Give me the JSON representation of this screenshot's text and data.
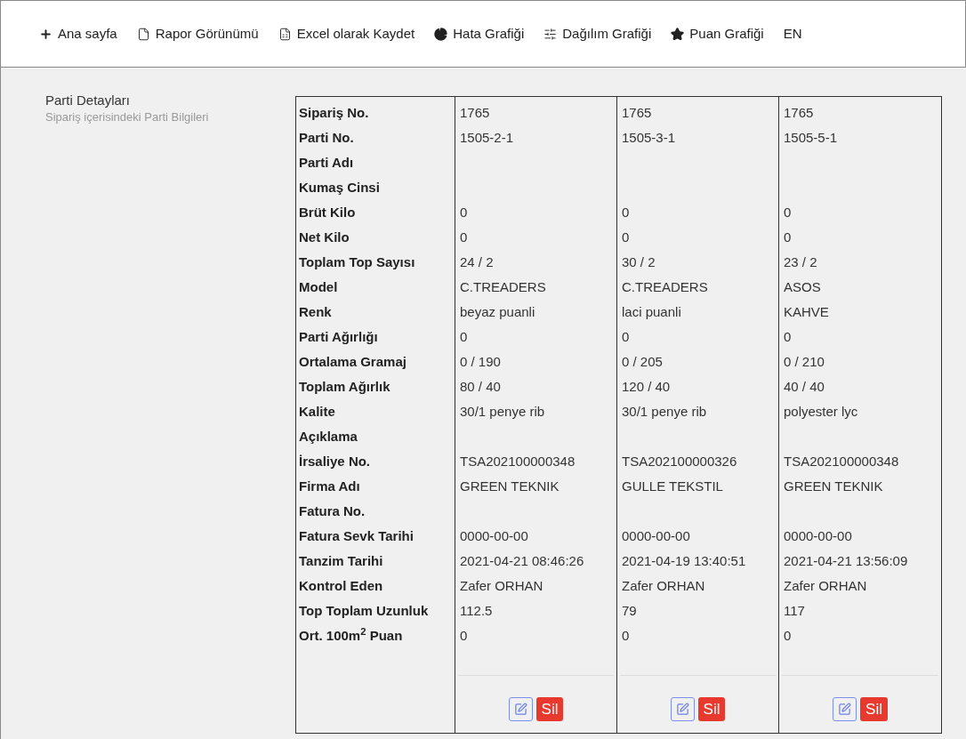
{
  "nav": [
    {
      "kind": "plus",
      "label": "Ana sayfa"
    },
    {
      "kind": "file",
      "label": "Rapor Görünümü"
    },
    {
      "kind": "excel",
      "label": "Excel olarak Kaydet"
    },
    {
      "kind": "pie",
      "label": "Hata Grafiği"
    },
    {
      "kind": "sliders",
      "label": "Dağılım Grafiği"
    },
    {
      "kind": "star",
      "label": "Puan Grafiği"
    },
    {
      "kind": "text",
      "label": "EN"
    }
  ],
  "section": {
    "title": "Parti Detayları",
    "subtitle": "Sipariş içerisindeki Parti Bilgileri"
  },
  "table": {
    "rows": [
      {
        "label": "Sipariş No.",
        "values": [
          "1765",
          "1765",
          "1765"
        ]
      },
      {
        "label": "Parti No.",
        "values": [
          "1505-2-1",
          "1505-3-1",
          "1505-5-1"
        ]
      },
      {
        "label": "Parti Adı"
      },
      {
        "label": "Kumaş Cinsi"
      },
      {
        "label": "Brüt Kilo",
        "values": [
          "0",
          "0",
          "0"
        ]
      },
      {
        "label": "Net Kilo",
        "values": [
          "0",
          "0",
          "0"
        ]
      },
      {
        "label": "Toplam Top Sayısı",
        "values": [
          "24 / 2",
          "30 / 2",
          "23 / 2"
        ]
      },
      {
        "label": "Model",
        "values": [
          "C.TREADERS",
          "C.TREADERS",
          "ASOS"
        ]
      },
      {
        "label": "Renk",
        "values": [
          "beyaz puanli",
          "laci puanli",
          "KAHVE"
        ]
      },
      {
        "label": "Parti Ağırlığı",
        "values": [
          "0",
          "0",
          "0"
        ]
      },
      {
        "label": "Ortalama Gramaj",
        "values": [
          "0 / 190",
          "0 / 205",
          "0 / 210"
        ]
      },
      {
        "label": "Toplam Ağırlık",
        "values": [
          "80 / 40",
          "120 / 40",
          "40 / 40"
        ]
      },
      {
        "label": "Kalite",
        "values": [
          "30/1 penye rib",
          "30/1 penye rib",
          "polyester lyc"
        ]
      },
      {
        "label": "Açıklama"
      },
      {
        "label": "İrsaliye No.",
        "values": [
          "TSA202100000348",
          "TSA202100000326",
          "TSA202100000348"
        ]
      },
      {
        "label": "Firma Adı",
        "values": [
          "GREEN TEKNIK",
          "GULLE TEKSTIL",
          "GREEN TEKNIK"
        ]
      },
      {
        "label": "Fatura No."
      },
      {
        "label": "Fatura Sevk Tarihi",
        "values": [
          "0000-00-00",
          "0000-00-00",
          "0000-00-00"
        ]
      },
      {
        "label": "Tanzim Tarihi",
        "values": [
          "2021-04-21 08:46:26",
          "2021-04-19 13:40:51",
          "2021-04-21 13:56:09"
        ]
      },
      {
        "label": "Kontrol Eden",
        "values": [
          "Zafer ORHAN",
          "Zafer ORHAN",
          "Zafer ORHAN"
        ]
      },
      {
        "label": "Top Toplam Uzunluk",
        "values": [
          "112.5",
          "79",
          "117"
        ]
      },
      {
        "label": "Ort. 100m$^{2}$ Puan",
        "values": [
          "0",
          "0",
          "0"
        ]
      }
    ],
    "delete_labels": [
      "Sil",
      "Sil",
      "Sil"
    ]
  }
}
